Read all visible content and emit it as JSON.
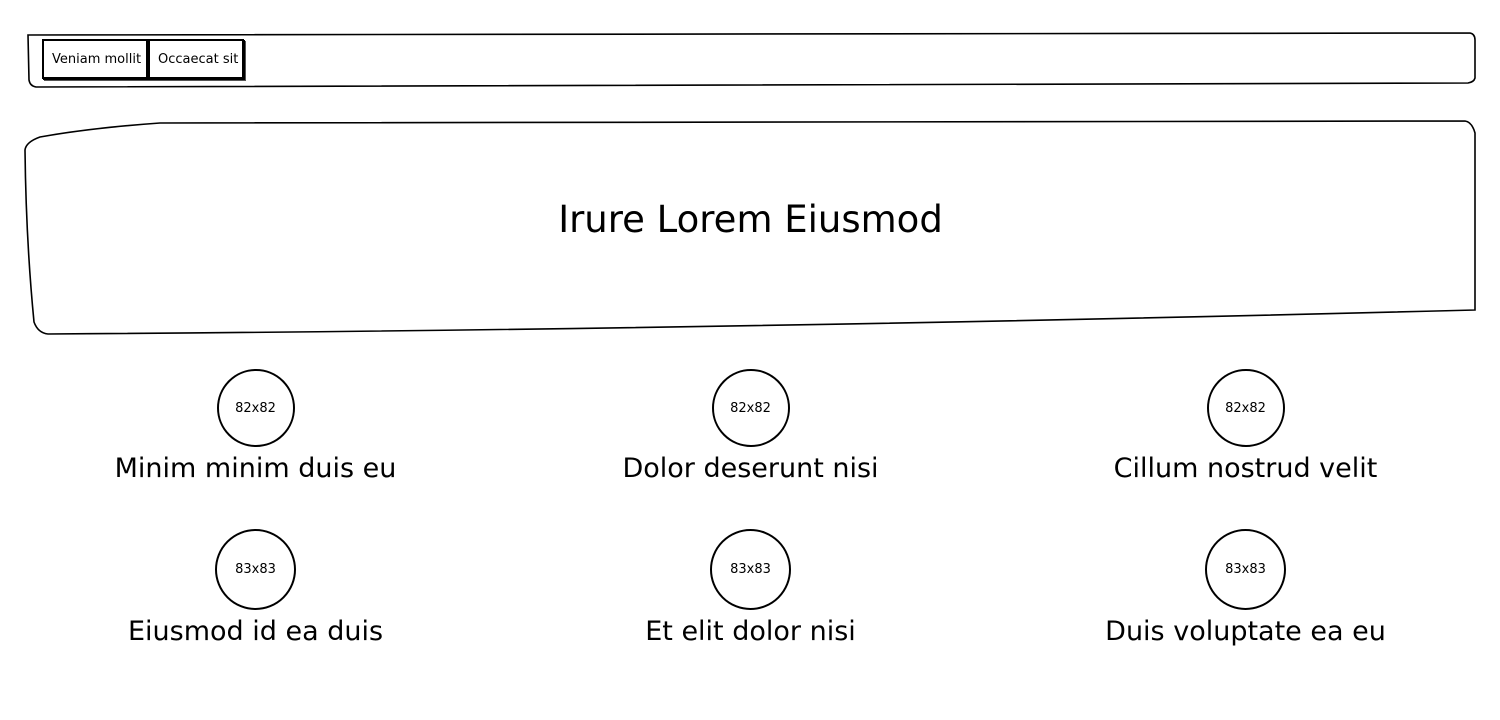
{
  "nav": {
    "buttons": [
      {
        "label": "Veniam mollit"
      },
      {
        "label": "Occaecat sit"
      }
    ]
  },
  "hero": {
    "title": "Irure Lorem Eiusmod"
  },
  "features": [
    {
      "image_label": "82x82",
      "title": "Minim minim duis eu"
    },
    {
      "image_label": "82x82",
      "title": "Dolor deserunt nisi"
    },
    {
      "image_label": "82x82",
      "title": "Cillum nostrud velit"
    },
    {
      "image_label": "83x83",
      "title": "Eiusmod id ea duis"
    },
    {
      "image_label": "83x83",
      "title": "Et elit dolor nisi"
    },
    {
      "image_label": "83x83",
      "title": "Duis voluptate ea eu"
    }
  ]
}
